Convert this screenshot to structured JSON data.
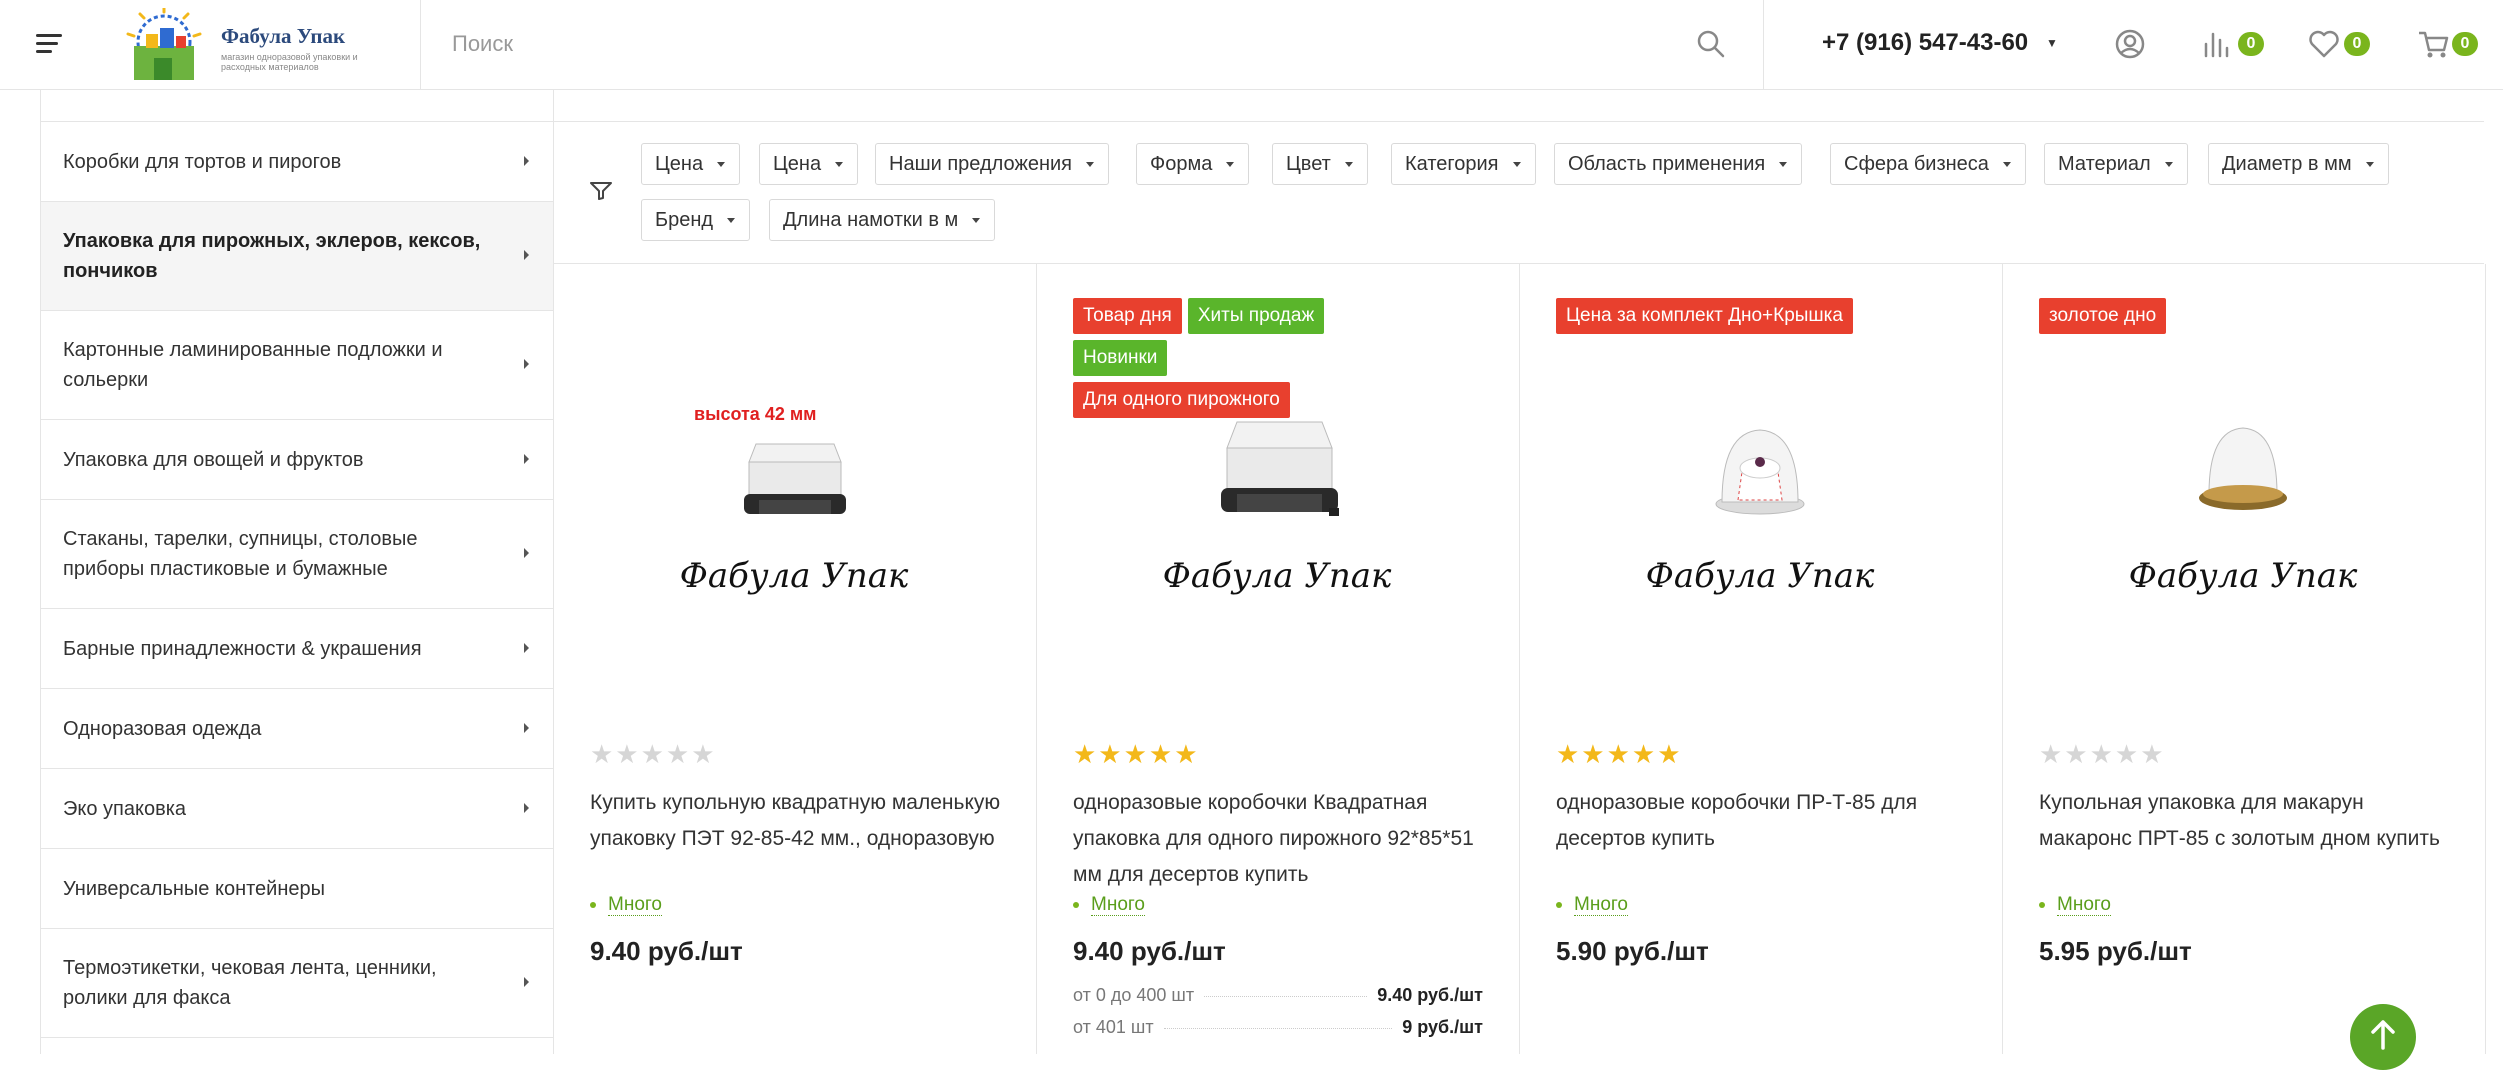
{
  "header": {
    "logo_title": "Фабула Упак",
    "logo_subtitle": "магазин одноразовой упаковки и расходных материалов",
    "search_placeholder": "Поиск",
    "phone": "+7 (916) 547-43-60",
    "compare_count": "0",
    "favorites_count": "0",
    "cart_count": "0"
  },
  "sidebar": {
    "items": [
      {
        "label": "Коробки для тортов и пирогов",
        "has_submenu": true
      },
      {
        "label": "Упаковка для пирожных, эклеров, кексов, пончиков",
        "has_submenu": true,
        "active": true
      },
      {
        "label": "Картонные ламинированные подложки и сольерки",
        "has_submenu": true
      },
      {
        "label": "Упаковка для овощей и фруктов",
        "has_submenu": true
      },
      {
        "label": "Стаканы, тарелки, супницы, столовые приборы пластиковые и бумажные",
        "has_submenu": true
      },
      {
        "label": "Барные принадлежности & украшения",
        "has_submenu": true
      },
      {
        "label": "Одноразовая одежда",
        "has_submenu": true
      },
      {
        "label": "Эко упаковка",
        "has_submenu": true
      },
      {
        "label": "Универсальные контейнеры",
        "has_submenu": false
      },
      {
        "label": "Термоэтикетки, чековая лента, ценники, ролики для факса",
        "has_submenu": true
      }
    ]
  },
  "filters": [
    "Цена",
    "Цена",
    "Наши предложения",
    "Форма",
    "Цвет",
    "Категория",
    "Область применения",
    "Сфера бизнеса",
    "Материал",
    "Диаметр в мм",
    "Бренд",
    "Длина намотки в м"
  ],
  "products": [
    {
      "badges": [],
      "image_caption": "высота 42 мм",
      "image_brand": "Фабула Упак",
      "rating": 0,
      "stars": "★★★★★",
      "title": "Купить купольную квадратную маленькую упаковку ПЭТ 92-85-42 мм., одноразовую",
      "stock": "Много",
      "price": "9.40 руб./шт",
      "tiers": []
    },
    {
      "badges": [
        {
          "label": "Товар дня",
          "color": "#e8402e"
        },
        {
          "label": "Хиты продаж",
          "color": "#5ab52b"
        },
        {
          "label": "Новинки",
          "color": "#5ab52b"
        },
        {
          "label": "Для одного пирожного",
          "color": "#e8402e"
        }
      ],
      "image_caption": "",
      "image_brand": "Фабула Упак",
      "rating": 5,
      "stars": "★★★★★",
      "title": "одноразовые коробочки Квадратная упаковка для одного пирожного 92*85*51 мм для десертов купить",
      "stock": "Много",
      "price": "9.40 руб./шт",
      "tiers": [
        {
          "label": "от 0 до 400 шт",
          "value": "9.40 руб./шт"
        },
        {
          "label": "от 401 шт",
          "value": "9 руб./шт"
        }
      ]
    },
    {
      "badges": [
        {
          "label": "Цена за комплект Дно+Крышка",
          "color": "#e8402e"
        }
      ],
      "image_caption": "",
      "image_brand": "Фабула Упак",
      "rating": 5,
      "stars": "★★★★★",
      "title": "одноразовые коробочки ПР-Т-85 для десертов купить",
      "stock": "Много",
      "price": "5.90 руб./шт",
      "tiers": []
    },
    {
      "badges": [
        {
          "label": "золотое дно",
          "color": "#e8402e"
        }
      ],
      "image_caption": "",
      "image_brand": "Фабула Упак",
      "rating": 0,
      "stars": "★★★★★",
      "title": "Купольная упаковка для макарун макаронс ПРТ-85 с золотым дном купить",
      "stock": "Много",
      "price": "5.95 руб./шт",
      "tiers": []
    }
  ],
  "colors": {
    "accent_green": "#7ab51d",
    "badge_red": "#e8402e",
    "badge_green": "#5ab52b",
    "star_gold": "#f3b81a"
  }
}
